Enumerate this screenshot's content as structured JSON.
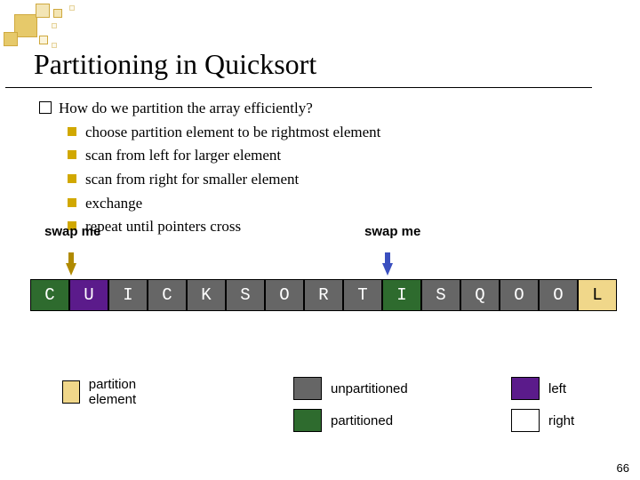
{
  "title": "Partitioning in Quicksort",
  "lead": "How do we partition the array efficiently?",
  "bullets": [
    "choose partition element to be rightmost element",
    "scan from left for larger element",
    "scan from right for smaller element",
    "exchange",
    "repeat until pointers cross"
  ],
  "labels": {
    "swap_left": "swap me",
    "swap_right": "swap me"
  },
  "array": {
    "cells": [
      {
        "v": "C",
        "cls": "c-green"
      },
      {
        "v": "U",
        "cls": "c-purple"
      },
      {
        "v": "I",
        "cls": "c-gray"
      },
      {
        "v": "C",
        "cls": "c-gray"
      },
      {
        "v": "K",
        "cls": "c-gray"
      },
      {
        "v": "S",
        "cls": "c-gray"
      },
      {
        "v": "O",
        "cls": "c-gray"
      },
      {
        "v": "R",
        "cls": "c-gray"
      },
      {
        "v": "T",
        "cls": "c-gray"
      },
      {
        "v": "I",
        "cls": "c-green"
      },
      {
        "v": "S",
        "cls": "c-gray"
      },
      {
        "v": "Q",
        "cls": "c-gray"
      },
      {
        "v": "O",
        "cls": "c-gray"
      },
      {
        "v": "O",
        "cls": "c-gray"
      },
      {
        "v": "L",
        "cls": "c-orange"
      }
    ]
  },
  "legend": {
    "partition": "partition element",
    "unpart": "unpartitioned",
    "part": "partitioned",
    "left": "left",
    "right": "right"
  },
  "colors": {
    "green": "#2e6b2e",
    "purple": "#5b1b8b",
    "gray": "#666666",
    "orange": "#f0d78a"
  },
  "page": "66"
}
